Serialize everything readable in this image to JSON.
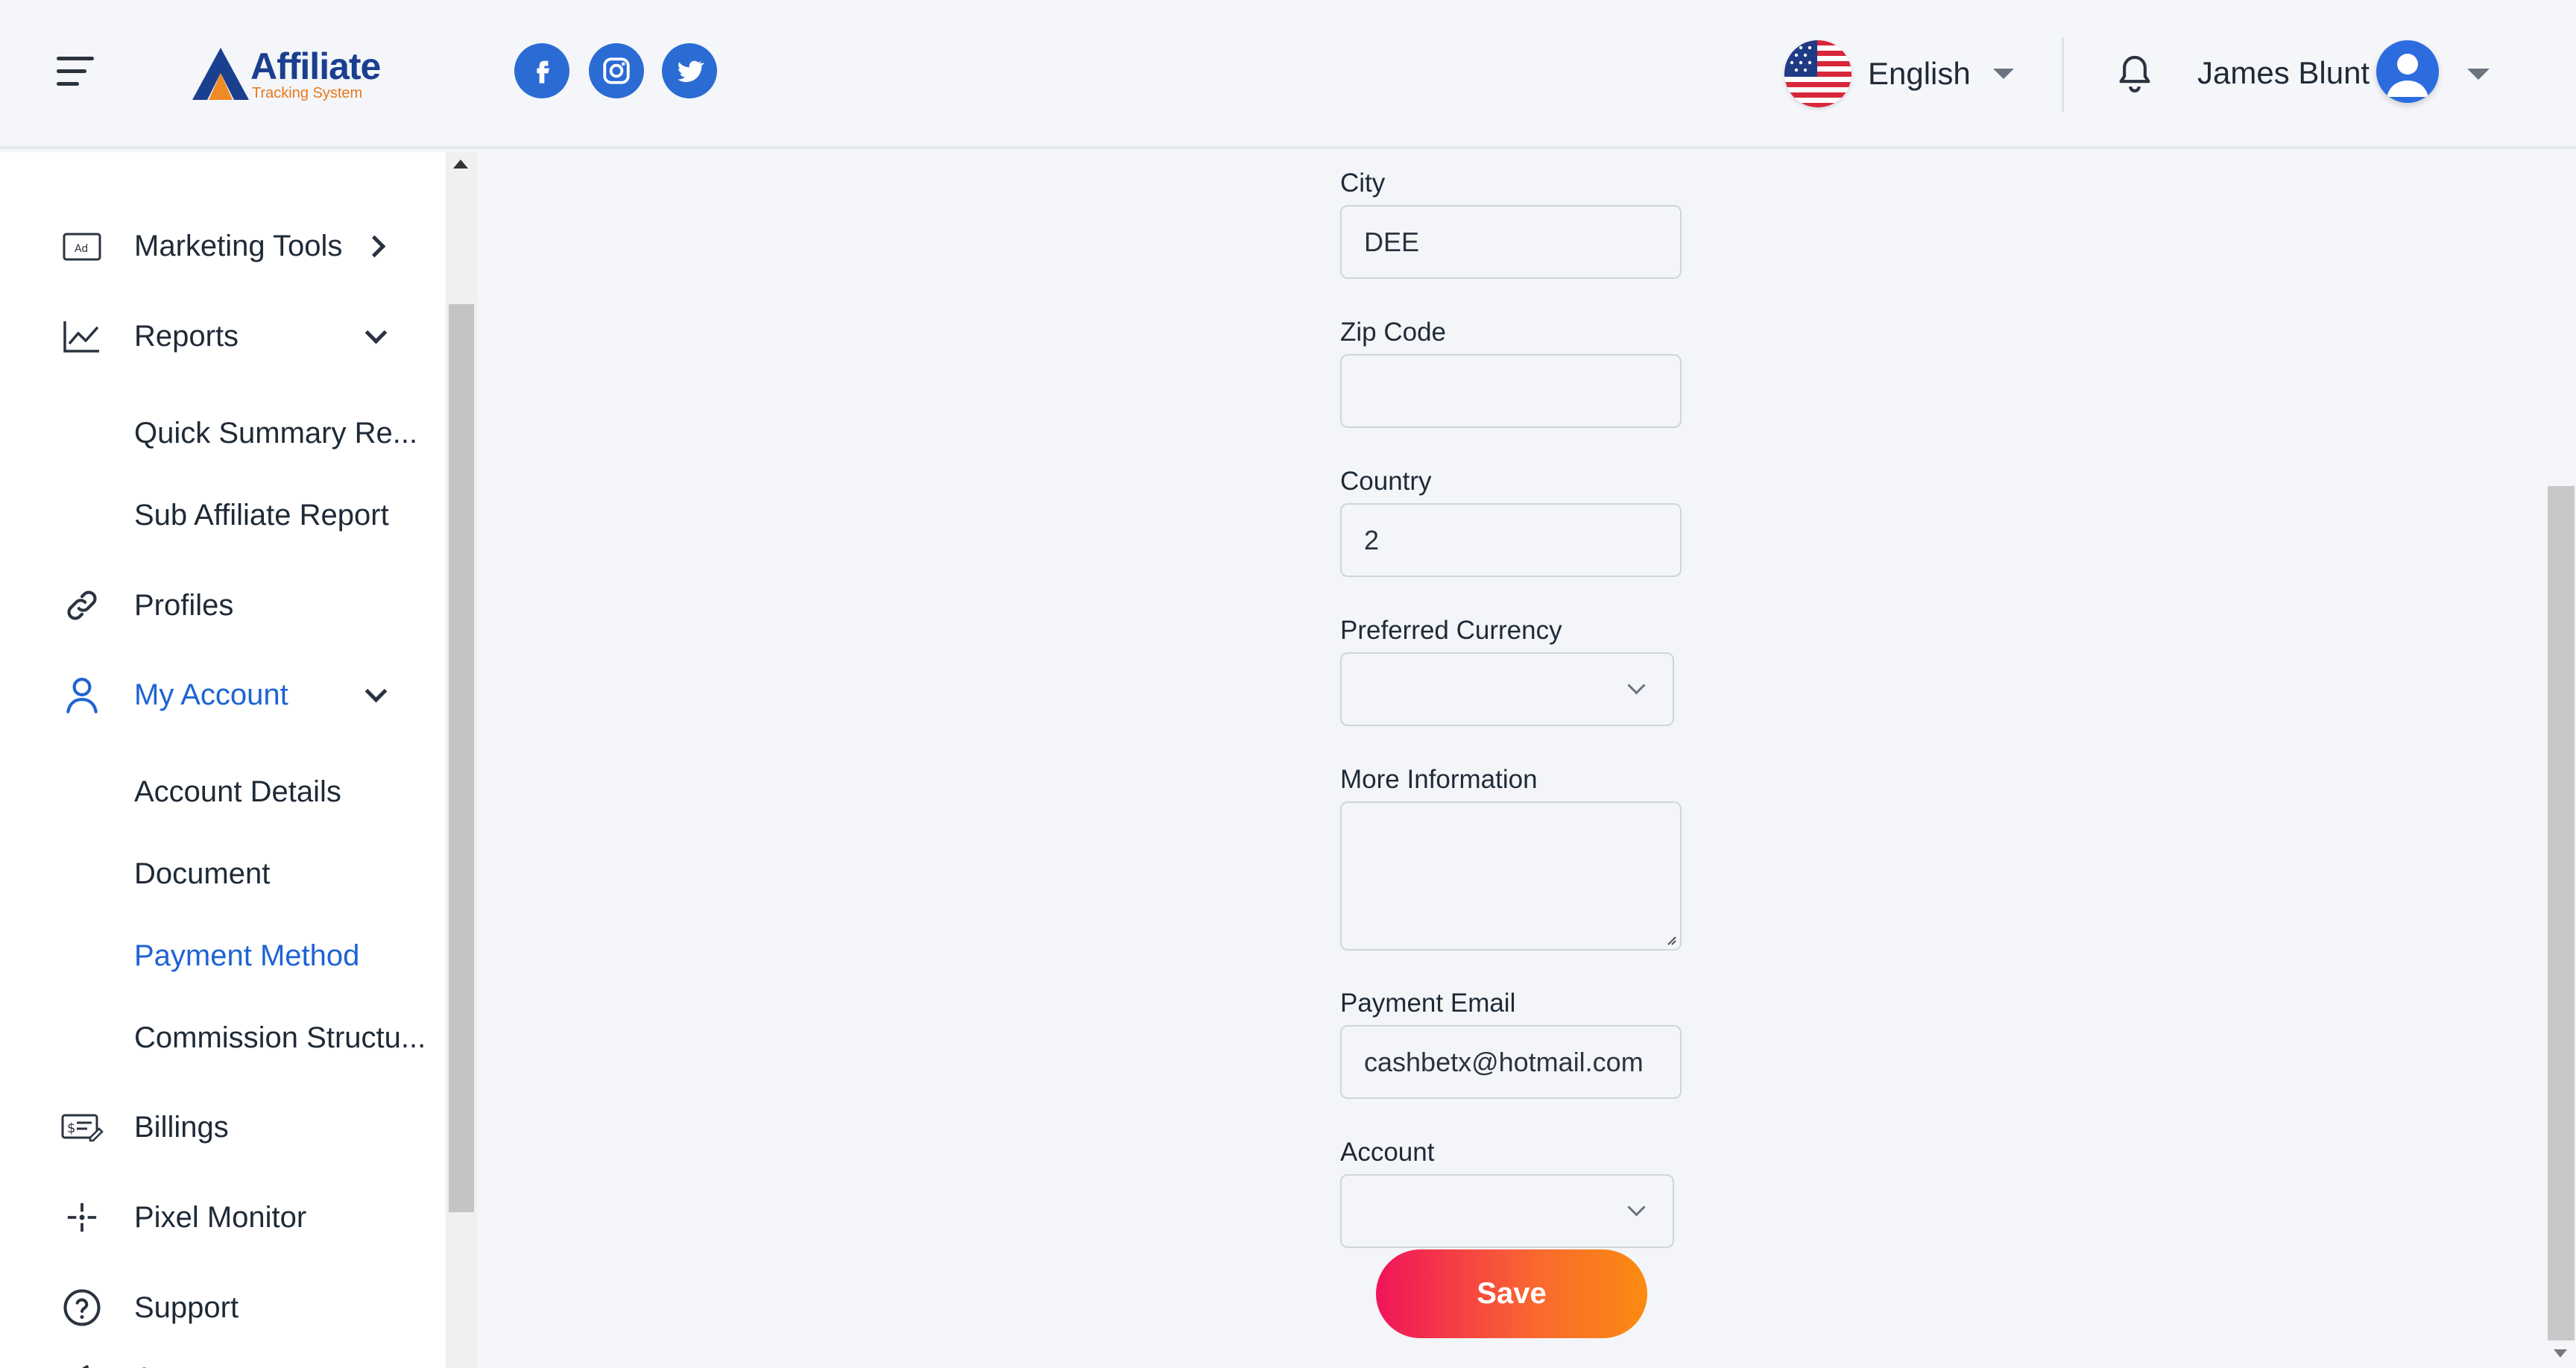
{
  "header": {
    "logo_title": "Affiliate",
    "logo_subtitle": "Tracking System",
    "language": "English",
    "user_name": "James Blunt",
    "social": [
      "facebook-icon",
      "instagram-icon",
      "twitter-icon"
    ],
    "accent_color": "#2d6cdf"
  },
  "sidebar": {
    "items": [
      {
        "label": "Marketing Tools",
        "icon": "ad-icon"
      },
      {
        "label": "Reports",
        "icon": "chart-line-icon"
      },
      {
        "label": "Quick Summary Re..."
      },
      {
        "label": "Sub Affiliate Report"
      },
      {
        "label": "Profiles",
        "icon": "link-icon"
      },
      {
        "label": "My Account",
        "icon": "user-icon",
        "active": true
      },
      {
        "label": "Account Details"
      },
      {
        "label": "Document"
      },
      {
        "label": "Payment Method",
        "active": true
      },
      {
        "label": "Commission Structu..."
      },
      {
        "label": "Billings",
        "icon": "billing-icon"
      },
      {
        "label": "Pixel Monitor",
        "icon": "pixel-icon"
      },
      {
        "label": "Support",
        "icon": "help-icon"
      },
      {
        "label": "Announcements",
        "icon": "megaphone-icon"
      }
    ]
  },
  "form": {
    "city": {
      "label": "City",
      "value": "DEE"
    },
    "zip": {
      "label": "Zip Code",
      "value": ""
    },
    "country": {
      "label": "Country",
      "value": "2"
    },
    "currency": {
      "label": "Preferred Currency",
      "value": ""
    },
    "more_info": {
      "label": "More Information",
      "value": ""
    },
    "payment_email": {
      "label": "Payment Email",
      "value": "cashbetx@hotmail.com"
    },
    "account": {
      "label": "Account",
      "value": ""
    },
    "save_label": "Save"
  }
}
